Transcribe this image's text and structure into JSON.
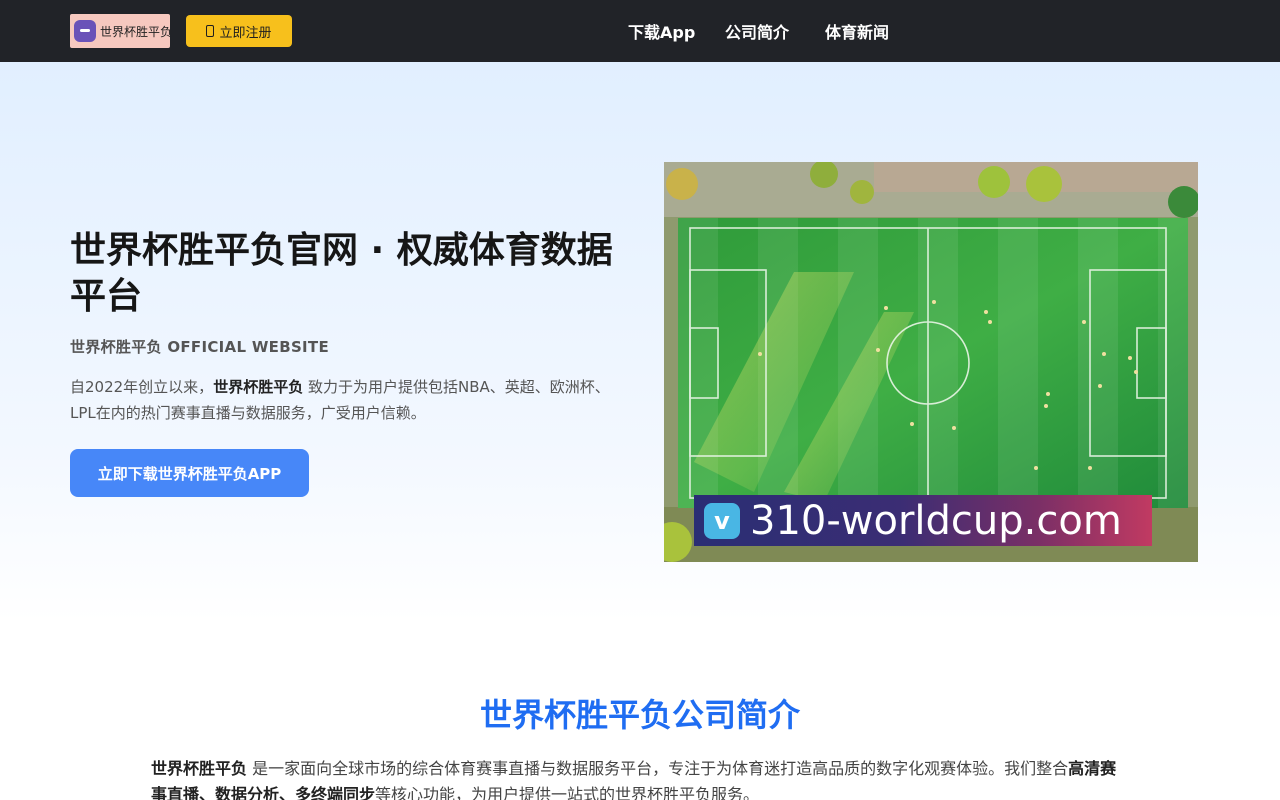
{
  "header": {
    "logo_text": "世界杯胜平负",
    "register_label": "立即注册",
    "nav": [
      {
        "label": "下载App"
      },
      {
        "label": "公司简介"
      },
      {
        "label": "体育新闻"
      }
    ]
  },
  "hero": {
    "title": "世界杯胜平负官网 · 权威体育数据平台",
    "subtitle": "世界杯胜平负 OFFICIAL WEBSITE",
    "desc_prefix": "自2022年创立以来，",
    "desc_brand": "世界杯胜平负",
    "desc_suffix": " 致力于为用户提供包括NBA、英超、欧洲杯、LPL在内的热门赛事直播与数据服务，广受用户信赖。",
    "download_label": "立即下载世界杯胜平负APP",
    "image": {
      "watermark_icon_letter": "v",
      "watermark_text": "310-worldcup.com"
    }
  },
  "about": {
    "title": "世界杯胜平负公司简介",
    "brand": "世界杯胜平负",
    "text_1": " 是一家面向全球市场的综合体育赛事直播与数据服务平台，专注于为体育迷打造高品质的数字化观赛体验。我们整合",
    "highlight": "高清赛事直播、数据分析、多终端同步",
    "text_2": "等核心功能，为用户提供一站式的世界杯胜平负服务。"
  },
  "colors": {
    "topbar": "#212328",
    "register": "#f7c01c",
    "download": "#4787f8",
    "about_title": "#1f6df2"
  }
}
